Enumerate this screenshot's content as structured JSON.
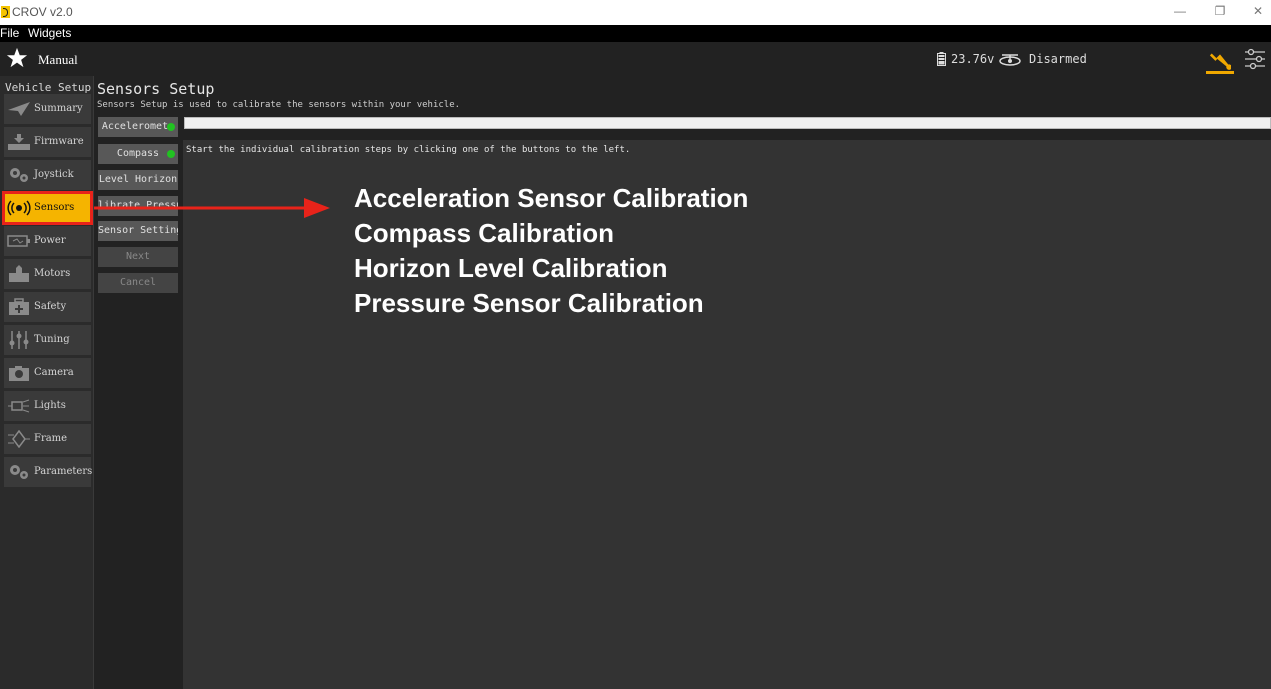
{
  "window": {
    "title": "CROV v2.0",
    "minimize_glyph": "—",
    "restore_glyph": "❐",
    "close_glyph": "✕"
  },
  "menubar": {
    "items": [
      "File",
      "Widgets"
    ]
  },
  "toolbar": {
    "mode": "Manual",
    "battery": "23.76v",
    "arm_status": "Disarmed",
    "accent_color": "#f0a800"
  },
  "sidebar": {
    "title": "Vehicle Setup",
    "items": [
      {
        "label": "Summary",
        "icon": "plane-icon"
      },
      {
        "label": "Firmware",
        "icon": "download-icon"
      },
      {
        "label": "Joystick",
        "icon": "gears-icon"
      },
      {
        "label": "Sensors",
        "icon": "radio-icon",
        "active": true
      },
      {
        "label": "Power",
        "icon": "battery-icon"
      },
      {
        "label": "Motors",
        "icon": "motor-icon"
      },
      {
        "label": "Safety",
        "icon": "medkit-icon"
      },
      {
        "label": "Tuning",
        "icon": "sliders-icon"
      },
      {
        "label": "Camera",
        "icon": "camera-icon"
      },
      {
        "label": "Lights",
        "icon": "light-icon"
      },
      {
        "label": "Frame",
        "icon": "frame-icon"
      },
      {
        "label": "Parameters",
        "icon": "gears-icon"
      }
    ]
  },
  "main": {
    "title": "Sensors Setup",
    "description": "Sensors Setup is used to calibrate the sensors within your vehicle.",
    "buttons": [
      "Acceleromete",
      "Compass",
      "Level Horizon",
      "librate Pressu",
      "Sensor Settings",
      "Next",
      "Cancel"
    ],
    "status": "Start the individual calibration steps by clicking one of the buttons to the left."
  },
  "annotation": {
    "lines": [
      "Acceleration Sensor Calibration",
      "Compass Calibration",
      "Horizon Level Calibration",
      "Pressure Sensor Calibration"
    ],
    "highlight_color": "#e8231a"
  }
}
